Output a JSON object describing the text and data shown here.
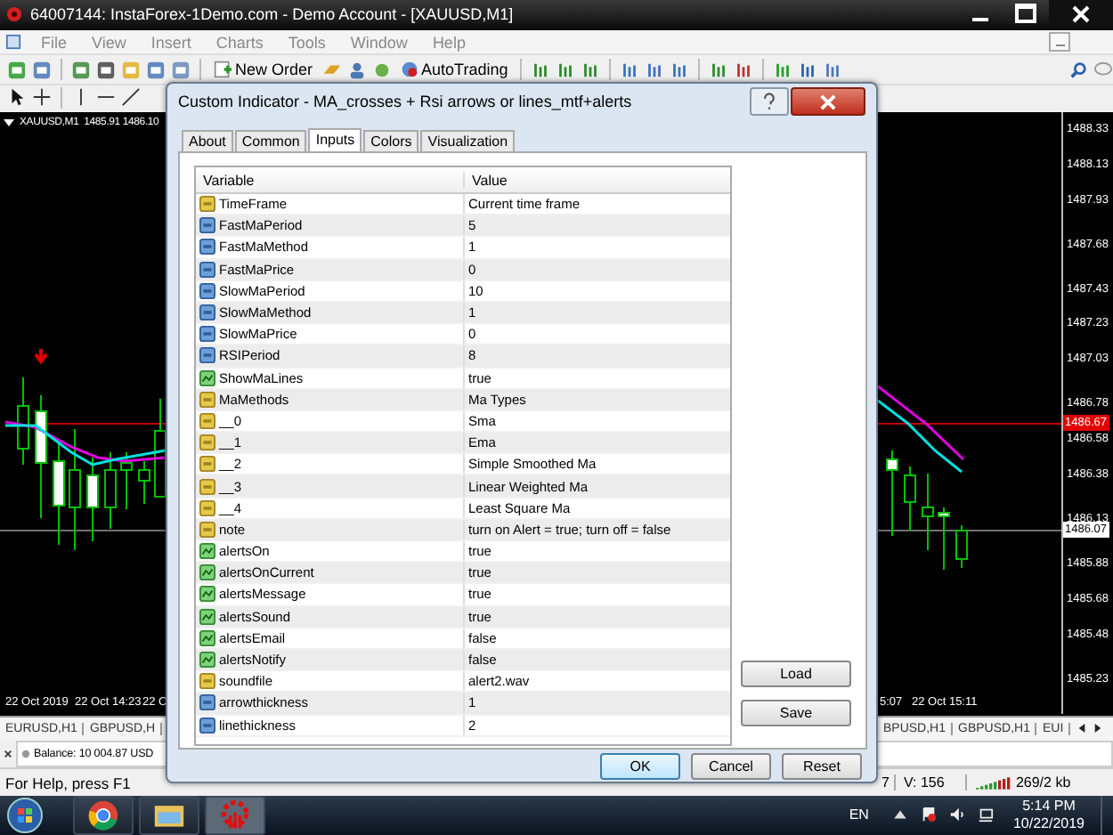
{
  "window": {
    "title": "64007144: InstaForex-1Demo.com - Demo Account - [XAUUSD,M1]"
  },
  "menu": [
    "File",
    "View",
    "Insert",
    "Charts",
    "Tools",
    "Window",
    "Help"
  ],
  "toolbar": {
    "buttons": [
      {
        "label": "New Order"
      },
      {
        "label": "AutoTrading"
      }
    ]
  },
  "chart": {
    "label": "XAUUSD,M1  1485.91 1486.10",
    "price_labels": [
      {
        "text": "1488.33",
        "kind": "grid"
      },
      {
        "text": "1488.13",
        "kind": "grid"
      },
      {
        "text": "1487.93",
        "kind": "grid"
      },
      {
        "text": "1487.68",
        "kind": "grid"
      },
      {
        "text": "1487.43",
        "kind": "grid"
      },
      {
        "text": "1487.23",
        "kind": "grid"
      },
      {
        "text": "1487.03",
        "kind": "grid"
      },
      {
        "text": "1486.78",
        "kind": "grid"
      },
      {
        "text": "1486.67",
        "kind": "ask"
      },
      {
        "text": "1486.58",
        "kind": "grid"
      },
      {
        "text": "1486.38",
        "kind": "grid"
      },
      {
        "text": "1486.13",
        "kind": "grid"
      },
      {
        "text": "1486.07",
        "kind": "bid"
      },
      {
        "text": "1485.88",
        "kind": "grid"
      },
      {
        "text": "1485.68",
        "kind": "grid"
      },
      {
        "text": "1485.48",
        "kind": "grid"
      },
      {
        "text": "1485.23",
        "kind": "grid"
      }
    ],
    "time_labels_left": [
      "22 Oct 2019",
      "22 Oct 14:23",
      "22 C"
    ],
    "time_labels_right": [
      "5:07",
      "22 Oct 15:11"
    ]
  },
  "symbol_tabs": {
    "left": [
      "EURUSD,H1",
      "GBPUSD,H"
    ],
    "right": [
      "BPUSD,H1",
      "GBPUSD,H1",
      "EUI"
    ]
  },
  "terminal": {
    "balance": "Balance: 10 004.87 USD"
  },
  "status_bar": {
    "help": "For Help, press F1",
    "fragment": "7",
    "volume": "V: 156",
    "traffic": "269/2 kb"
  },
  "dialog": {
    "title": "Custom Indicator - MA_crosses + Rsi arrows or lines_mtf+alerts",
    "tabs": [
      {
        "label": "About",
        "selected": false
      },
      {
        "label": "Common",
        "selected": false
      },
      {
        "label": "Inputs",
        "selected": true
      },
      {
        "label": "Colors",
        "selected": false
      },
      {
        "label": "Visualization",
        "selected": false
      }
    ],
    "columns": [
      "Variable",
      "Value"
    ],
    "rows": [
      {
        "kind": "string",
        "name": "TimeFrame",
        "value": "Current time frame"
      },
      {
        "kind": "int",
        "name": "FastMaPeriod",
        "value": "5"
      },
      {
        "kind": "int",
        "name": "FastMaMethod",
        "value": "1"
      },
      {
        "kind": "int",
        "name": "FastMaPrice",
        "value": "0"
      },
      {
        "kind": "int",
        "name": "SlowMaPeriod",
        "value": "10"
      },
      {
        "kind": "int",
        "name": "SlowMaMethod",
        "value": "1"
      },
      {
        "kind": "int",
        "name": "SlowMaPrice",
        "value": "0"
      },
      {
        "kind": "int",
        "name": "RSIPeriod",
        "value": "8"
      },
      {
        "kind": "bool",
        "name": "ShowMaLines",
        "value": "true"
      },
      {
        "kind": "string",
        "name": "MaMethods",
        "value": "Ma Types"
      },
      {
        "kind": "string",
        "name": "__0",
        "value": "Sma"
      },
      {
        "kind": "string",
        "name": "__1",
        "value": "Ema"
      },
      {
        "kind": "string",
        "name": "__2",
        "value": "Simple Smoothed Ma"
      },
      {
        "kind": "string",
        "name": "__3",
        "value": "Linear Weighted Ma"
      },
      {
        "kind": "string",
        "name": "__4",
        "value": "Least Square Ma"
      },
      {
        "kind": "string",
        "name": "note",
        "value": "turn on Alert = true; turn off = false"
      },
      {
        "kind": "bool",
        "name": "alertsOn",
        "value": "true"
      },
      {
        "kind": "bool",
        "name": "alertsOnCurrent",
        "value": "true"
      },
      {
        "kind": "bool",
        "name": "alertsMessage",
        "value": "true"
      },
      {
        "kind": "bool",
        "name": "alertsSound",
        "value": "true"
      },
      {
        "kind": "bool",
        "name": "alertsEmail",
        "value": "false"
      },
      {
        "kind": "bool",
        "name": "alertsNotify",
        "value": "false"
      },
      {
        "kind": "string",
        "name": "soundfile",
        "value": "alert2.wav"
      },
      {
        "kind": "int",
        "name": "arrowthickness",
        "value": "1"
      },
      {
        "kind": "int",
        "name": "linethickness",
        "value": "2"
      }
    ],
    "side_buttons": [
      "Load",
      "Save"
    ],
    "buttons": [
      {
        "label": "OK",
        "default": true
      },
      {
        "label": "Cancel",
        "default": false
      },
      {
        "label": "Reset",
        "default": false
      }
    ]
  },
  "taskbar": {
    "language": "EN",
    "time": "5:14 PM",
    "date": "10/22/2019"
  }
}
